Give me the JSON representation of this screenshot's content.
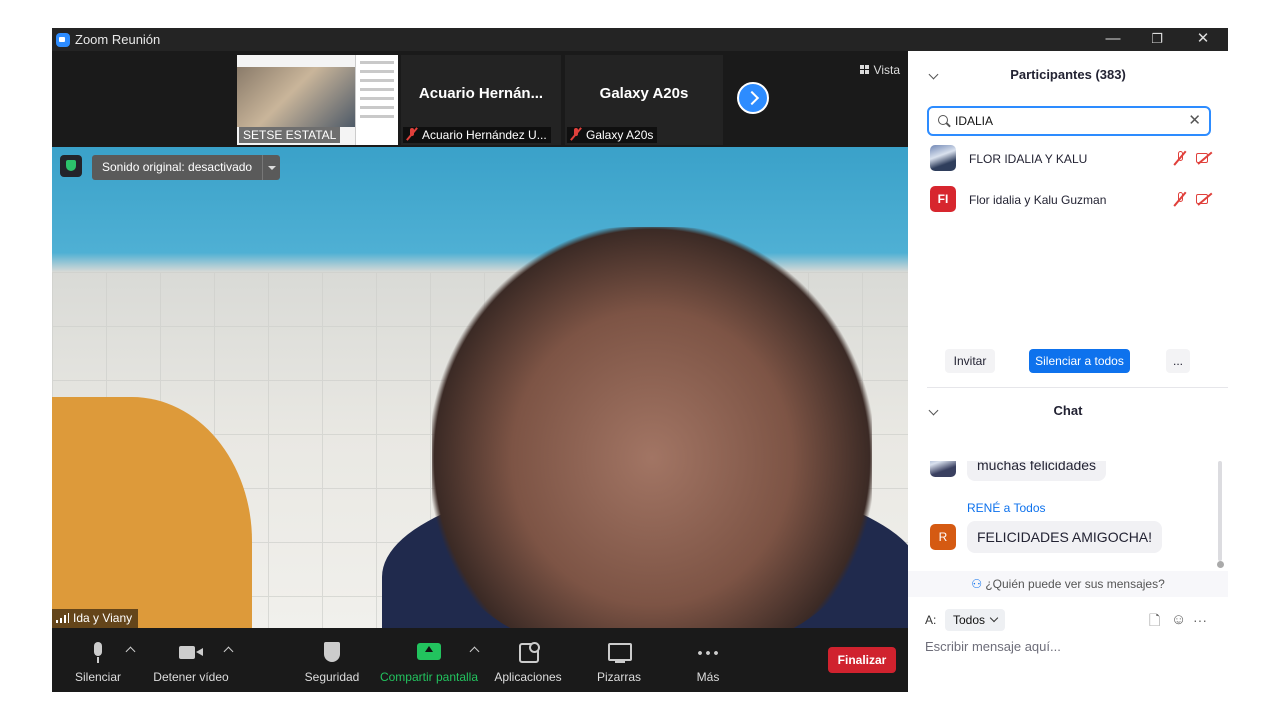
{
  "window": {
    "title": "Zoom Reunión",
    "minimize_icon": "—",
    "restore_icon": "❐",
    "close_icon": "✕"
  },
  "video": {
    "thumbnails": [
      {
        "name": "SETSE ESTATAL",
        "label": "SETSE ESTATAL",
        "muted": false
      },
      {
        "name": "Acuario  Hernán...",
        "label": "Acuario Hernández U...",
        "muted": true
      },
      {
        "name": "Galaxy A20s",
        "label": "Galaxy A20s",
        "muted": true
      }
    ],
    "view_label": "Vista",
    "original_sound": "Sonido original: desactivado",
    "speaker": "Ida y Viany"
  },
  "toolbar": {
    "mute": "Silenciar",
    "stop_video": "Detener vídeo",
    "security": "Seguridad",
    "share": "Compartir pantalla",
    "apps": "Aplicaciones",
    "whiteboards": "Pizarras",
    "more": "Más",
    "end": "Finalizar"
  },
  "participants": {
    "title": "Participantes (383)",
    "search_value": "IDALIA",
    "list": [
      {
        "name": "FLOR IDALIA  Y KALU",
        "avatar": "",
        "avatar_color": "#2f3e5c"
      },
      {
        "name": "Flor idalia y Kalu Guzman",
        "avatar": "FI",
        "avatar_color": "#d7262e"
      }
    ],
    "invite": "Invitar",
    "mute_all": "Silenciar a todos",
    "more": "..."
  },
  "chat": {
    "title": "Chat",
    "messages": [
      {
        "sender": "",
        "text": "muchas felicidades",
        "avatar": "",
        "avatar_color": "#3a4060"
      },
      {
        "sender": "RENÉ a Todos",
        "text": "FELICIDADES AMIGOCHA!",
        "avatar": "R",
        "avatar_color": "#d55a12"
      }
    ],
    "who_sees": "¿Quién puede ver sus mensajes?",
    "to_label": "A:",
    "recipient": "Todos",
    "placeholder": "Escribir mensaje aquí...",
    "file_icon": "🗋",
    "emoji_icon": "☺",
    "more_icon": "···"
  },
  "colors": {
    "accent": "#2d8cff",
    "share_green": "#22c35e",
    "end_red": "#d0222e",
    "muted_red": "#e0403b"
  }
}
